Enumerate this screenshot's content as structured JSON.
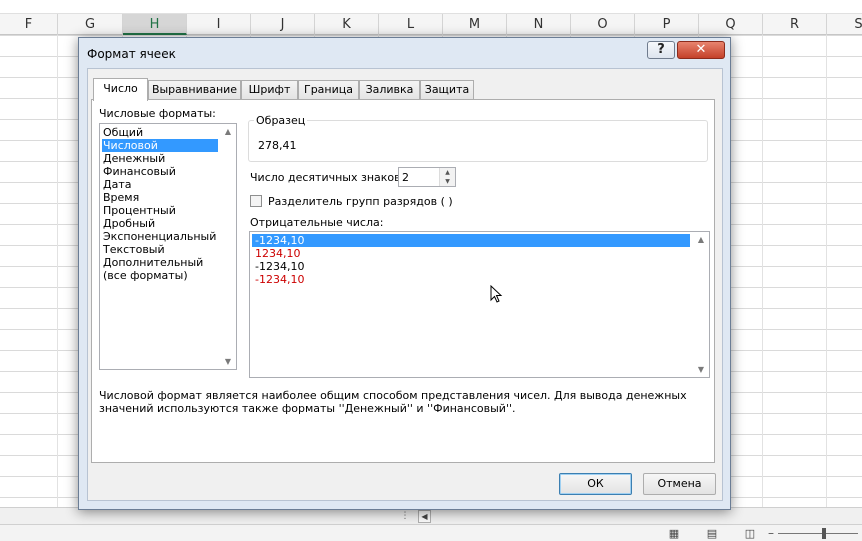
{
  "columns": [
    "F",
    "G",
    "H",
    "I",
    "J",
    "K",
    "L",
    "M",
    "N",
    "O",
    "P",
    "Q",
    "R",
    "S"
  ],
  "selected_column": "H",
  "dialog": {
    "title": "Формат ячеек",
    "help_label": "?",
    "close_label": "✕",
    "tabs": [
      {
        "label": "Число",
        "active": true
      },
      {
        "label": "Выравнивание",
        "active": false
      },
      {
        "label": "Шрифт",
        "active": false
      },
      {
        "label": "Граница",
        "active": false
      },
      {
        "label": "Заливка",
        "active": false
      },
      {
        "label": "Защита",
        "active": false
      }
    ],
    "formats_label": "Числовые форматы:",
    "formats": [
      "Общий",
      "Числовой",
      "Денежный",
      "Финансовый",
      "Дата",
      "Время",
      "Процентный",
      "Дробный",
      "Экспоненциальный",
      "Текстовый",
      "Дополнительный",
      "(все форматы)"
    ],
    "selected_format": "Числовой",
    "sample_label": "Образец",
    "sample_value": "278,41",
    "decimals_label": "Число десятичных знаков:",
    "decimals_value": "2",
    "separator_label": "Разделитель групп разрядов ( )",
    "separator_checked": false,
    "negative_label": "Отрицательные числа:",
    "negative_formats": [
      {
        "text": "-1234,10",
        "color": "#000000",
        "selected": true
      },
      {
        "text": "1234,10",
        "color": "#cc0000",
        "selected": false
      },
      {
        "text": "-1234,10",
        "color": "#000000",
        "selected": false
      },
      {
        "text": "-1234,10",
        "color": "#cc0000",
        "selected": false
      }
    ],
    "description": "Числовой формат является наиболее общим способом представления чисел. Для вывода денежных значений используются также форматы ''Денежный'' и ''Финансовый''.",
    "ok_label": "ОК",
    "cancel_label": "Отмена"
  },
  "colors": {
    "selection": "#3399ff",
    "negative_red": "#cc0000",
    "excel_green": "#217346"
  }
}
